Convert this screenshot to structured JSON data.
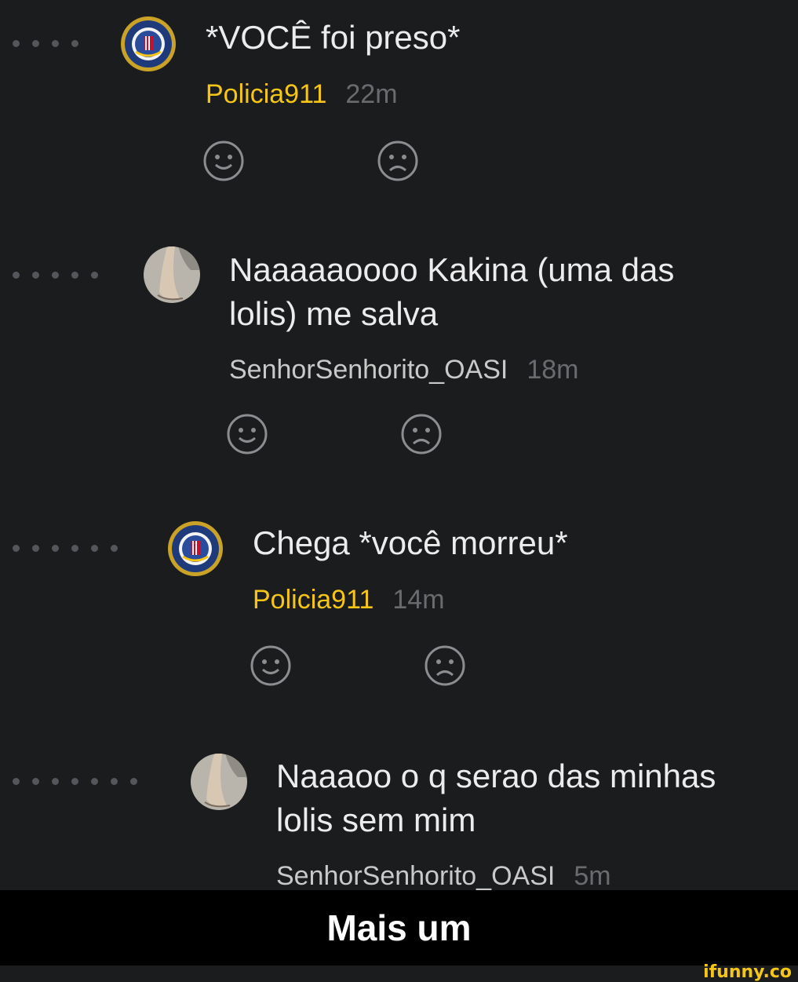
{
  "comments": [
    {
      "text": "*VOCÊ foi preso*",
      "username": "Policia911",
      "time": "22m",
      "avatar": "fbi-seal-icon",
      "username_color": "#f5c518"
    },
    {
      "text": "Naaaaaoooo Kakina (uma das\nlolis) me salva",
      "username": "SenhorSenhorito_OASI",
      "time": "18m",
      "avatar": "foot-photo",
      "username_color": "#c9c9c9"
    },
    {
      "text": "Chega *você morreu*",
      "username": "Policia911",
      "time": "14m",
      "avatar": "fbi-seal-icon",
      "username_color": "#f5c518"
    },
    {
      "text": "Naaaoo o q serao das minhas\nlolis sem mim",
      "username": "SenhorSenhorito_OASI",
      "time": "5m",
      "avatar": "foot-photo",
      "username_color": "#c9c9c9"
    }
  ],
  "reactions": {
    "like_icon": "smile-icon",
    "dislike_icon": "frown-icon"
  },
  "caption": "Mais um",
  "watermark": "ifunny.co",
  "colors": {
    "background": "#1b1c1e",
    "police_username": "#f5c518",
    "caption_bar": "#000000"
  }
}
